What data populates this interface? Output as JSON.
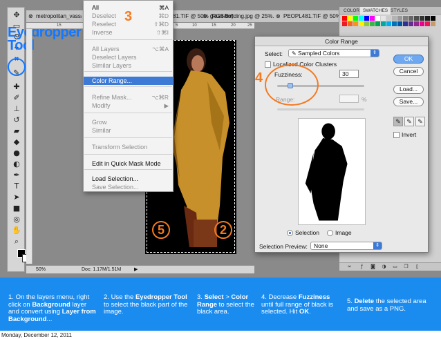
{
  "document_tabs": [
    {
      "label": "metropolitan_vassar..."
    },
    {
      "label": "81.TIF @ 50% (RGB/8#) *"
    },
    {
      "label": "glass-building.jpg @ 25%..."
    },
    {
      "label": "PEOPL481.TIF @ 50% (RGB"
    }
  ],
  "ruler_marks": [
    "15",
    "5",
    "10",
    "15",
    "20",
    "25"
  ],
  "annotation_tool_label": "Eyedropper Tool",
  "status_bar": {
    "zoom": "50%",
    "doc": "Doc: 1.17M/1.51M"
  },
  "select_menu": {
    "step_number": "3",
    "items": [
      {
        "label": "All",
        "shortcut": "⌘A",
        "disabled": false
      },
      {
        "label": "Deselect",
        "shortcut": "⌘D",
        "disabled": true
      },
      {
        "label": "Reselect",
        "shortcut": "⇧⌘D",
        "disabled": true
      },
      {
        "label": "Inverse",
        "shortcut": "⇧⌘I",
        "disabled": true
      },
      {
        "label": "All Layers",
        "shortcut": "⌥⌘A",
        "disabled": true
      },
      {
        "label": "Deselect Layers",
        "shortcut": "",
        "disabled": true
      },
      {
        "label": "Similar Layers",
        "shortcut": "",
        "disabled": true
      },
      {
        "label": "Color Range...",
        "shortcut": "",
        "disabled": false,
        "active": true
      },
      {
        "label": "Refine Mask...",
        "shortcut": "⌥⌘R",
        "disabled": true
      },
      {
        "label": "Modify",
        "shortcut": "▶",
        "disabled": true
      },
      {
        "label": "Grow",
        "shortcut": "",
        "disabled": true
      },
      {
        "label": "Similar",
        "shortcut": "",
        "disabled": true
      },
      {
        "label": "Transform Selection",
        "shortcut": "",
        "disabled": true
      },
      {
        "label": "Edit in Quick Mask Mode",
        "shortcut": "",
        "disabled": false
      },
      {
        "label": "Load Selection...",
        "shortcut": "",
        "disabled": false
      },
      {
        "label": "Save Selection...",
        "shortcut": "",
        "disabled": true
      }
    ]
  },
  "canvas": {
    "badge_left": "5",
    "badge_right": "2"
  },
  "color_range": {
    "title": "Color Range",
    "select_label": "Select:",
    "select_value": "Sampled Colors",
    "localized_label": "Localized Color Clusters",
    "fuzziness_label": "Fuzziness:",
    "fuzziness_value": "30",
    "fuzziness_fraction": 0.15,
    "range_label": "Range:",
    "range_unit": "%",
    "step_number": "4",
    "radio_selection": "Selection",
    "radio_image": "Image",
    "selection_preview_label": "Selection Preview:",
    "selection_preview_value": "None",
    "invert_label": "Invert",
    "buttons": {
      "ok": "OK",
      "cancel": "Cancel",
      "load": "Load...",
      "save": "Save..."
    }
  },
  "swatches_panel": {
    "tabs": [
      "COLOR",
      "SWATCHES",
      "STYLES"
    ],
    "active_tab": "SWATCHES",
    "colors": [
      "#ff0000",
      "#ffff00",
      "#00ff00",
      "#00ffff",
      "#0000ff",
      "#ff00ff",
      "#ffffff",
      "#e6e6e6",
      "#cccccc",
      "#b3b3b3",
      "#999999",
      "#808080",
      "#666666",
      "#4d4d4d",
      "#333333",
      "#1a1a1a",
      "#000000",
      "#ed1c24",
      "#f26522",
      "#f7941d",
      "#fff200",
      "#8dc63f",
      "#39b54a",
      "#00a651",
      "#00a99d",
      "#00aeef",
      "#0072bc",
      "#0054a6",
      "#2e3192",
      "#662d91",
      "#92278f",
      "#ec008c",
      "#ed145b",
      "#c69c6d"
    ]
  },
  "instructions": [
    {
      "parts": [
        [
          "On the layers menu, right click on ",
          false
        ],
        [
          "Background",
          true
        ],
        [
          " layer and convert using ",
          false
        ],
        [
          "Layer from Background",
          true
        ],
        [
          "...",
          false
        ]
      ],
      "number": "1."
    },
    {
      "parts": [
        [
          "Use the ",
          false
        ],
        [
          "Eyedropper Tool",
          true
        ],
        [
          " to select the black part of the image.",
          false
        ]
      ],
      "number": "2."
    },
    {
      "parts": [
        [
          "Select",
          true
        ],
        [
          " > ",
          false
        ],
        [
          "Color Range",
          true
        ],
        [
          " to select the black area.",
          false
        ]
      ],
      "number": "3."
    },
    {
      "parts": [
        [
          "Decrease ",
          false
        ],
        [
          "Fuzziness",
          true
        ],
        [
          " until full range of black is selected. Hit ",
          false
        ],
        [
          "OK",
          true
        ],
        [
          ".",
          false
        ]
      ],
      "number": "4."
    },
    {
      "parts": [
        [
          "Delete",
          true
        ],
        [
          " the selected area and save as a PNG.",
          false
        ]
      ],
      "number": "5."
    }
  ],
  "date": "Monday, December 12, 2011",
  "colors": {
    "accent_blue": "#1a8cf0",
    "annotation_orange": "#f47a20",
    "highlight_blue": "#1478ff"
  }
}
